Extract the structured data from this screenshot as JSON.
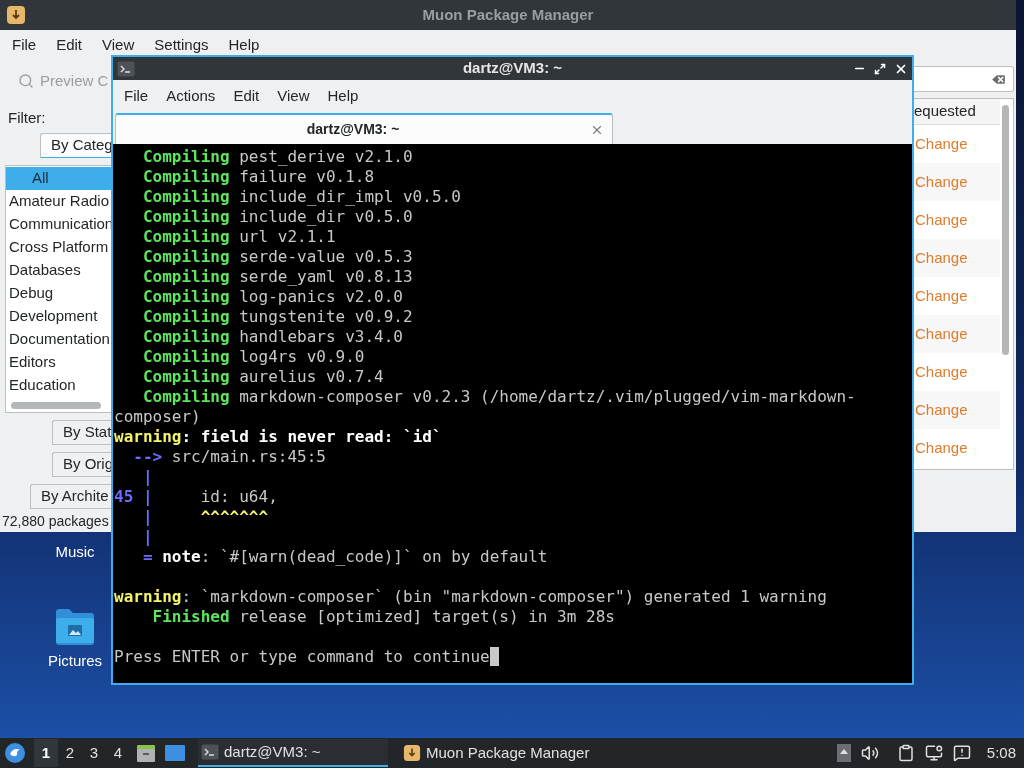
{
  "muon": {
    "title": "Muon Package Manager",
    "menu": [
      "File",
      "Edit",
      "View",
      "Settings",
      "Help"
    ],
    "preview_button": "Preview C",
    "filter_label": "Filter:",
    "sections": [
      {
        "label": "By Categ",
        "expanded": true
      },
      {
        "label": "By Stat",
        "expanded": false
      },
      {
        "label": "By Orig",
        "expanded": false
      },
      {
        "label": "By Archite",
        "expanded": false
      }
    ],
    "categories": [
      {
        "label": "All",
        "selected": true
      },
      {
        "label": "Amateur Radio",
        "selected": false
      },
      {
        "label": "Communication",
        "selected": false
      },
      {
        "label": "Cross Platform",
        "selected": false
      },
      {
        "label": "Databases",
        "selected": false
      },
      {
        "label": "Debug",
        "selected": false
      },
      {
        "label": "Development",
        "selected": false
      },
      {
        "label": "Documentation",
        "selected": false
      },
      {
        "label": "Editors",
        "selected": false
      },
      {
        "label": "Education",
        "selected": false
      }
    ],
    "status": "72,880 packages",
    "column_header": "equested",
    "rows": [
      {
        "action": "Change"
      },
      {
        "action": "Change"
      },
      {
        "action": "Change"
      },
      {
        "action": "Change"
      },
      {
        "action": "Change"
      },
      {
        "action": "Change"
      },
      {
        "action": "Change"
      },
      {
        "action": "Change"
      },
      {
        "action": "Change"
      }
    ]
  },
  "terminal": {
    "title": "dartz@VM3: ~",
    "menu": [
      "File",
      "Actions",
      "Edit",
      "View",
      "Help"
    ],
    "tabs": [
      {
        "label": "dartz@VM3: ~",
        "selected": true
      }
    ],
    "lines": [
      {
        "segments": [
          {
            "text": "   Compiling",
            "kind": "green"
          },
          {
            "text": " pest_derive v2.1.0",
            "kind": "plain"
          }
        ]
      },
      {
        "segments": [
          {
            "text": "   Compiling",
            "kind": "green"
          },
          {
            "text": " failure v0.1.8",
            "kind": "plain"
          }
        ]
      },
      {
        "segments": [
          {
            "text": "   Compiling",
            "kind": "green"
          },
          {
            "text": " include_dir_impl v0.5.0",
            "kind": "plain"
          }
        ]
      },
      {
        "segments": [
          {
            "text": "   Compiling",
            "kind": "green"
          },
          {
            "text": " include_dir v0.5.0",
            "kind": "plain"
          }
        ]
      },
      {
        "segments": [
          {
            "text": "   Compiling",
            "kind": "green"
          },
          {
            "text": " url v2.1.1",
            "kind": "plain"
          }
        ]
      },
      {
        "segments": [
          {
            "text": "   Compiling",
            "kind": "green"
          },
          {
            "text": " serde-value v0.5.3",
            "kind": "plain"
          }
        ]
      },
      {
        "segments": [
          {
            "text": "   Compiling",
            "kind": "green"
          },
          {
            "text": " serde_yaml v0.8.13",
            "kind": "plain"
          }
        ]
      },
      {
        "segments": [
          {
            "text": "   Compiling",
            "kind": "green"
          },
          {
            "text": " log-panics v2.0.0",
            "kind": "plain"
          }
        ]
      },
      {
        "segments": [
          {
            "text": "   Compiling",
            "kind": "green"
          },
          {
            "text": " tungstenite v0.9.2",
            "kind": "plain"
          }
        ]
      },
      {
        "segments": [
          {
            "text": "   Compiling",
            "kind": "green"
          },
          {
            "text": " handlebars v3.4.0",
            "kind": "plain"
          }
        ]
      },
      {
        "segments": [
          {
            "text": "   Compiling",
            "kind": "green"
          },
          {
            "text": " log4rs v0.9.0",
            "kind": "plain"
          }
        ]
      },
      {
        "segments": [
          {
            "text": "   Compiling",
            "kind": "green"
          },
          {
            "text": " aurelius v0.7.4",
            "kind": "plain"
          }
        ]
      },
      {
        "segments": [
          {
            "text": "   Compiling",
            "kind": "green"
          },
          {
            "text": " markdown-composer v0.2.3 (/home/dartz/.vim/plugged/vim-markdown-",
            "kind": "plain"
          }
        ]
      },
      {
        "segments": [
          {
            "text": "composer)",
            "kind": "plain"
          }
        ]
      },
      {
        "segments": [
          {
            "text": "warning",
            "kind": "yellow"
          },
          {
            "text": ": field is never read: `id`",
            "kind": "white"
          }
        ]
      },
      {
        "segments": [
          {
            "text": "  -->",
            "kind": "blue"
          },
          {
            "text": " src/main.rs:45:5",
            "kind": "plain"
          }
        ]
      },
      {
        "segments": [
          {
            "text": "   |",
            "kind": "blue"
          }
        ]
      },
      {
        "segments": [
          {
            "text": "45 |",
            "kind": "blue"
          },
          {
            "text": "     id: u64,",
            "kind": "plain"
          }
        ]
      },
      {
        "segments": [
          {
            "text": "   |",
            "kind": "blue"
          },
          {
            "text": "     ^^^^^^^",
            "kind": "yellow"
          }
        ]
      },
      {
        "segments": [
          {
            "text": "   |",
            "kind": "blue"
          }
        ]
      },
      {
        "segments": [
          {
            "text": "   =",
            "kind": "blue"
          },
          {
            "text": " note",
            "kind": "white"
          },
          {
            "text": ": `#[warn(dead_code)]` on by default",
            "kind": "plain"
          }
        ]
      },
      {
        "kind": "blank"
      },
      {
        "kind": "output",
        "segments": [
          {
            "text": "warning",
            "kind": "yellow"
          },
          {
            "text": ": `markdown-composer` (bin \"markdown-composer\") generated 1 warning",
            "kind": "plain"
          }
        ]
      },
      {
        "segments": [
          {
            "text": "    Finished",
            "kind": "green"
          },
          {
            "text": " release [optimized] target(s) in 3m 28s",
            "kind": "plain"
          }
        ]
      },
      {
        "kind": "blank"
      },
      {
        "kind": "output",
        "cursor": true,
        "segments": [
          {
            "text": "Press ENTER or type command to continue",
            "kind": "plain"
          }
        ]
      }
    ]
  },
  "desktop_icons": [
    {
      "label": "Music",
      "kind": "hidden"
    },
    {
      "label": "Pictures",
      "kind": "folder"
    }
  ],
  "taskbar": {
    "workspaces": [
      {
        "label": "1",
        "selected": true
      },
      {
        "label": "2",
        "selected": false
      },
      {
        "label": "3",
        "selected": false
      },
      {
        "label": "4",
        "selected": false
      }
    ],
    "tasks": [
      {
        "label": "dartz@VM3: ~",
        "kind": "terminal",
        "selected": true
      },
      {
        "label": "Muon Package Manager",
        "kind": "package",
        "selected": false
      }
    ],
    "clock": "5:08"
  }
}
